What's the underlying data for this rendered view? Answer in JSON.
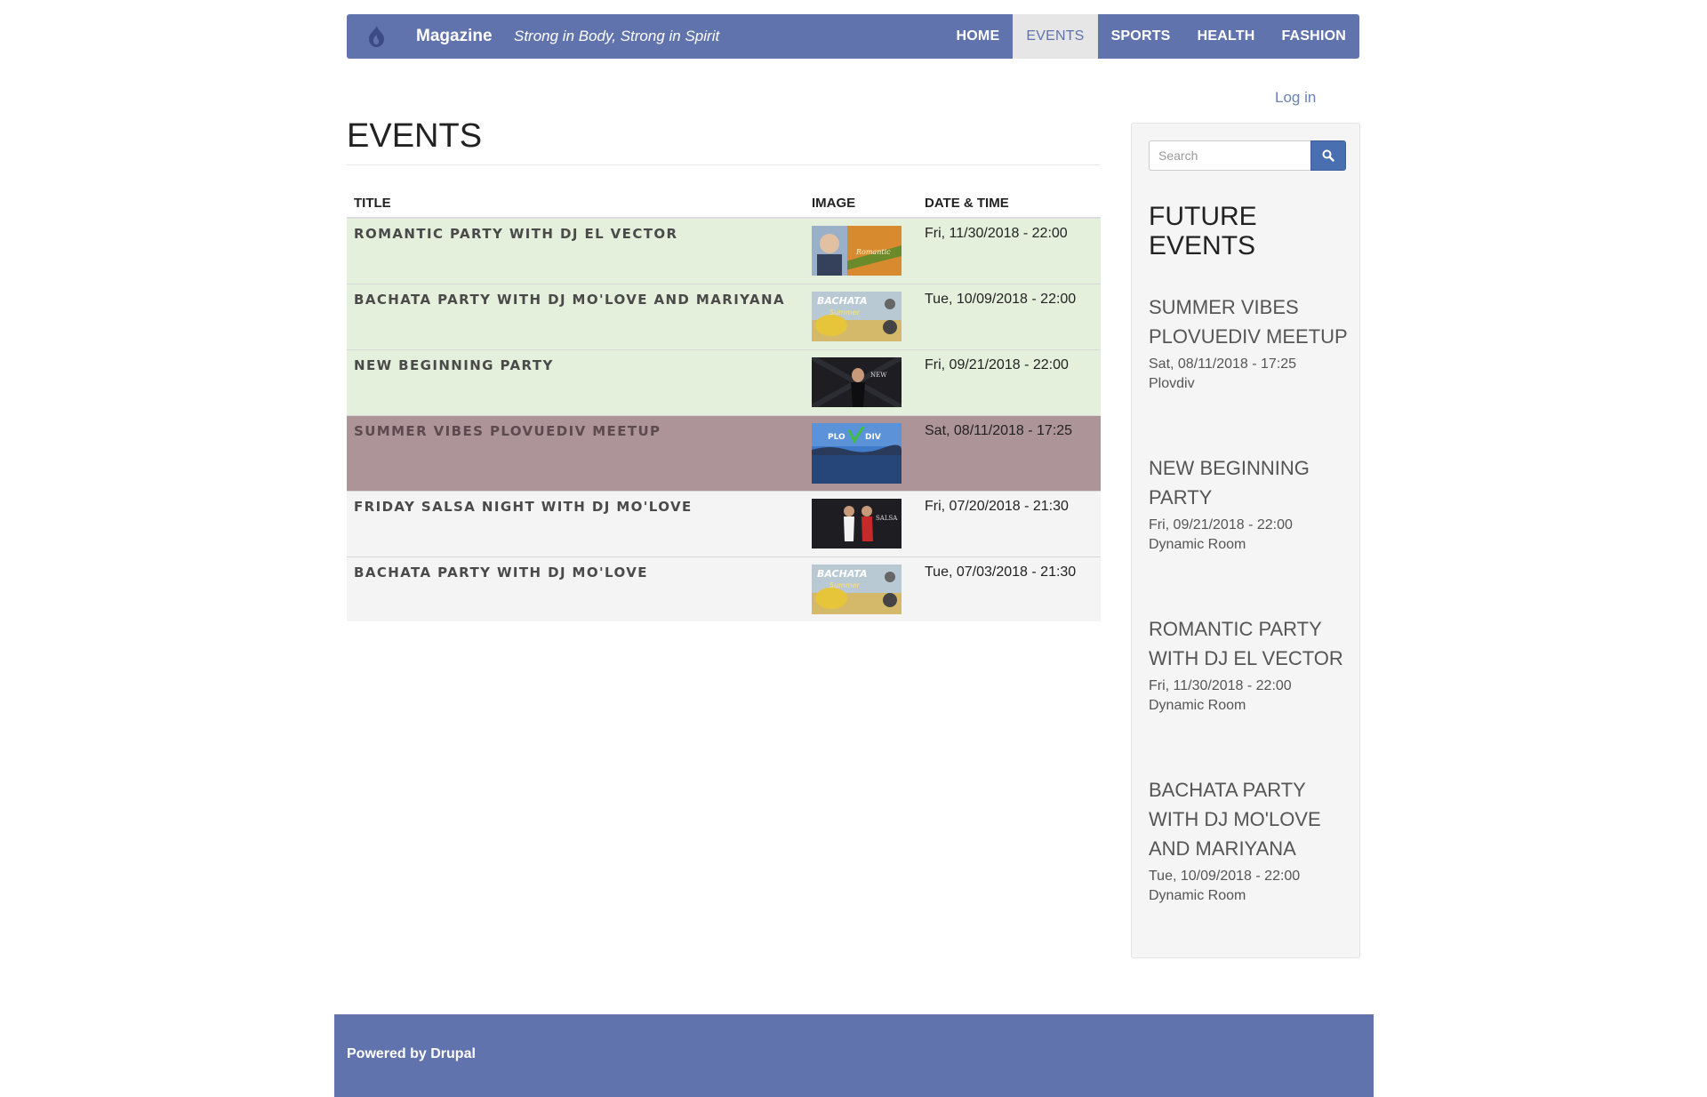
{
  "header": {
    "brand": "Magazine",
    "slogan": "Strong in Body, Strong in Spirit",
    "nav": [
      {
        "label": "HOME",
        "active": false
      },
      {
        "label": "EVENTS",
        "active": true
      },
      {
        "label": "SPORTS",
        "active": false
      },
      {
        "label": "HEALTH",
        "active": false
      },
      {
        "label": "FASHION",
        "active": false
      }
    ]
  },
  "user": {
    "login_label": "Log in"
  },
  "main": {
    "title": "EVENTS",
    "columns": [
      "TITLE",
      "IMAGE",
      "DATE & TIME"
    ],
    "rows": [
      {
        "title": "ROMANTIC PARTY WITH DJ EL VECTOR",
        "date": "Fri, 11/30/2018 - 22:00",
        "status": "future",
        "image": "romantic-party-thumbnail"
      },
      {
        "title": "BACHATA PARTY WITH DJ MO'LOVE AND MARIYANA",
        "date": "Tue, 10/09/2018 - 22:00",
        "status": "future",
        "image": "bachata-summer-thumbnail"
      },
      {
        "title": "NEW BEGINNING PARTY",
        "date": "Fri, 09/21/2018 - 22:00",
        "status": "future",
        "image": "new-beginning-thumbnail"
      },
      {
        "title": "SUMMER VIBES PLOVUEDIV MEETUP",
        "date": "Sat, 08/11/2018 - 17:25",
        "status": "current",
        "image": "plovdiv-lake-thumbnail"
      },
      {
        "title": "FRIDAY SALSA NIGHT WITH DJ MO'LOVE",
        "date": "Fri, 07/20/2018 - 21:30",
        "status": "past",
        "image": "salsa-night-thumbnail"
      },
      {
        "title": "BACHATA PARTY WITH DJ MO'LOVE",
        "date": "Tue, 07/03/2018 - 21:30",
        "status": "past",
        "image": "bachata-summer-thumbnail"
      }
    ]
  },
  "sidebar": {
    "search_placeholder": "Search",
    "heading": "FUTURE EVENTS",
    "events": [
      {
        "title": "SUMMER VIBES PLOVUEDIV MEETUP",
        "date": "Sat, 08/11/2018 - 17:25",
        "location": "Plovdiv"
      },
      {
        "title": "NEW BEGINNING PARTY",
        "date": "Fri, 09/21/2018 - 22:00",
        "location": "Dynamic Room"
      },
      {
        "title": "ROMANTIC PARTY WITH DJ EL VECTOR",
        "date": "Fri, 11/30/2018 - 22:00",
        "location": "Dynamic Room"
      },
      {
        "title": "BACHATA PARTY WITH DJ MO'LOVE AND MARIYANA",
        "date": "Tue, 10/09/2018 - 22:00",
        "location": "Dynamic Room"
      }
    ]
  },
  "footer": {
    "text": "Powered by Drupal"
  },
  "colors": {
    "brand": "#6073ad",
    "future_row": "#e5f0dc",
    "current_row": "#ac9499",
    "past_row": "#f4f4f4"
  }
}
